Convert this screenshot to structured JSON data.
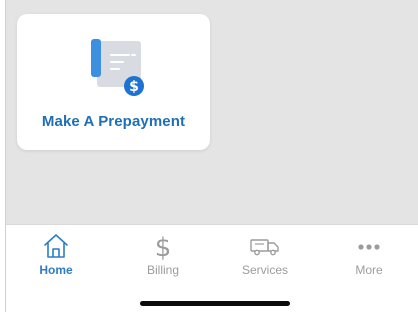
{
  "card": {
    "label": "Make A Prepayment",
    "icon": "document-dollar-icon"
  },
  "tabs": [
    {
      "label": "Home",
      "icon": "home-icon",
      "active": true
    },
    {
      "label": "Billing",
      "icon": "dollar-icon",
      "active": false
    },
    {
      "label": "Services",
      "icon": "truck-icon",
      "active": false
    },
    {
      "label": "More",
      "icon": "more-dots-icon",
      "active": false
    }
  ],
  "colors": {
    "accent": "#2e7cc4",
    "inactive": "#9c9c9e",
    "background": "#e4e4e5",
    "card": "#ffffff"
  }
}
